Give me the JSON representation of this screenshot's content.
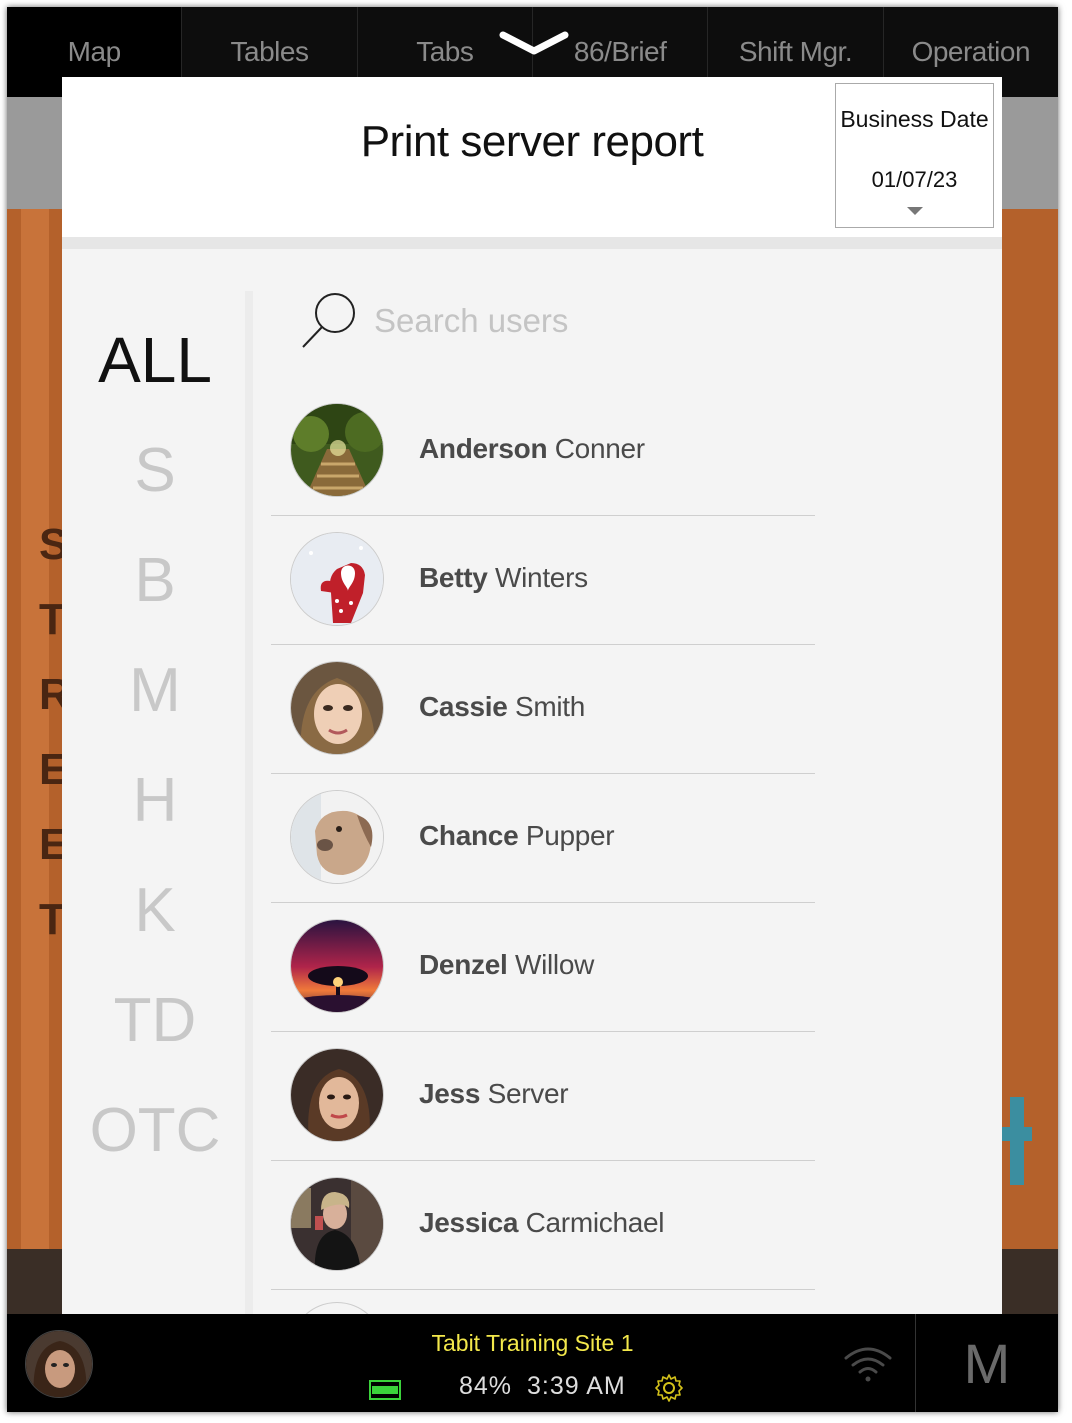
{
  "nav": {
    "tabs": [
      "Map",
      "Tables",
      "Tabs",
      "86/Brief",
      "Shift Mgr.",
      "Operation"
    ]
  },
  "modal": {
    "title": "Print server report",
    "business_date": {
      "label": "Business Date",
      "value": "01/07/23"
    },
    "letter_index": [
      "ALL",
      "S",
      "B",
      "M",
      "H",
      "K",
      "TD",
      "OTC"
    ],
    "active_letter": "ALL",
    "search": {
      "placeholder": "Search users",
      "value": ""
    },
    "users": [
      {
        "first": "Anderson",
        "last": "Conner",
        "avatar": "forest-boardwalk"
      },
      {
        "first": "Betty",
        "last": "Winters",
        "avatar": "snow-heart-mitten"
      },
      {
        "first": "Cassie",
        "last": "Smith",
        "avatar": "woman-portrait"
      },
      {
        "first": "Chance",
        "last": "Pupper",
        "avatar": "dog-photo"
      },
      {
        "first": "Denzel",
        "last": "Willow",
        "avatar": "tree-sunset"
      },
      {
        "first": "Jess",
        "last": "Server",
        "avatar": "woman-portrait"
      },
      {
        "first": "Jessica",
        "last": "Carmichael",
        "avatar": "woman-dark-photo"
      }
    ]
  },
  "footer": {
    "site_name": "Tabit Training Site 1",
    "battery_percent": "84%",
    "time": "3:39 AM",
    "m_button_label": "M"
  },
  "colors": {
    "site_name": "#f3e84b",
    "battery": "#3bd13b",
    "settings_icon": "#d4c21a",
    "background_panel": "#b4612b"
  }
}
